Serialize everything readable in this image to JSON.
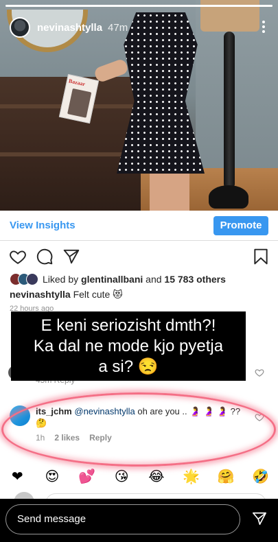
{
  "story": {
    "progress_fraction": 1.0,
    "username": "nevinashtylla",
    "time": "47m"
  },
  "post": {
    "view_insights_label": "View Insights",
    "promote_label": "Promote",
    "liked_by_prefix": "Liked by ",
    "liked_by_user": "glentinallbani",
    "liked_by_and": " and ",
    "liked_by_count": "15 783 others",
    "caption_user": "nevinashtylla",
    "caption_text": " Felt cute 😻",
    "posted_ago": "22 hours ago",
    "hidden_comment_meta": "45m   Reply"
  },
  "overlay": {
    "line1": "E keni seriozisht dmth?!",
    "line2": "Ka dal ne mode kjo pyetja",
    "line3": "a si? 😒"
  },
  "comment": {
    "user": "its_jchm",
    "mention": "@nevinashtylla",
    "text": " oh are you .. 🤰 🤰 🤰 ?? 🤔",
    "time": "1h",
    "likes": "2 likes",
    "reply_label": "Reply"
  },
  "emoji_bar": [
    "❤️",
    "🙌",
    "🔥",
    "👏",
    "😢",
    "😍",
    "😮",
    "😂"
  ],
  "emoji_bar_display": [
    "❤",
    "😍",
    "💕",
    "😘",
    "😂",
    "🌟",
    "🤗",
    "🤣"
  ],
  "reply_bar": {
    "placeholder": "Send message"
  },
  "colors": {
    "accent_blue": "#3897f0",
    "highlight_pink": "#f46f86"
  }
}
